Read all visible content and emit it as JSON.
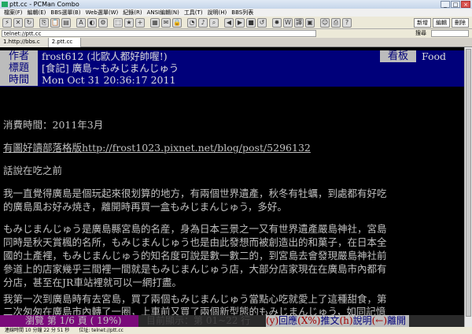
{
  "window": {
    "title": "ptt.cc - PCMan Combo"
  },
  "menu": [
    "檔案(F)",
    "編輯(E)",
    "BBS選單(B)",
    "Web選單(W)",
    "紀錄(R)",
    "ANSI編輯(N)",
    "工具(T)",
    "說明(H)",
    "BBS列表"
  ],
  "toolbar": {
    "right_buttons": [
      "新增",
      "編輯",
      "刪除"
    ]
  },
  "address": {
    "value": "telnet://ptt.cc",
    "search_label": "搜尋"
  },
  "tabs": [
    "1.http://bbs.c",
    "2.ptt.cc"
  ],
  "article": {
    "author_label": "作者",
    "author_value": "frost612 (北歐人都好帥喔!)",
    "board_label": "看板",
    "board_value": "Food",
    "title_label": "標題",
    "title_value": "[食記] 廣島~もみじまんじゅう",
    "time_label": "時間",
    "time_value": "Mon Oct 31 20:36:17 2011",
    "lines": [
      "消費時間：2011年3月",
      "有圖好讀部落格版http://frost1023.pixnet.net/blog/post/5296132",
      "話說在吃之前",
      "我一直覺得廣島是個玩起來很划算的地方，有兩個世界遺產，秋冬有牡蠣，到處都有好吃",
      "的廣島風お好み焼き，離開時再買一盒もみじまんじゅう，多好。",
      "もみじまんじゅう是廣島縣宮島的名産，身為日本三景之一又有世界遺產嚴島神社，宮島",
      "同時是秋天賞楓的名所，もみじまんじゅう也是由此發想而被創造出的和菓子，在日本全",
      "國的土產裡，もみじまんじゅう的知名度可說是數一數二的，到宮島去會發現嚴島神社前",
      "參道上的店家幾乎三間裡一間就是もみじまんじゅう店，大部分店家現在在廣島市內都有",
      "分店，甚至在JR車站裡就可以一網打盡。",
      "我第一次到廣島時有去宮島，買了兩個もみじまんじゅう當點心吃就愛上了這種甜食，第",
      "二次匆匆在廣島市內轉了一圈，上車前又買了兩個新型態的もみじまんじゅう，如同記憶"
    ]
  },
  "status_line": {
    "page": "瀏覽 第 1/6 頁 ( 19%)",
    "lines": "目前顯示：第 01~22 行",
    "cmd_reply_key": "(y)",
    "cmd_reply": "回應",
    "cmd_push_key": "(X%)",
    "cmd_push": "推文",
    "cmd_help_key": "(h)",
    "cmd_help": "說明",
    "cmd_exit_key": "(←)",
    "cmd_exit": "離開"
  },
  "statusbar": {
    "text": "連線時間 10 分鐘 22 分 51 秒　　位址: telnet://ptt.cc"
  }
}
